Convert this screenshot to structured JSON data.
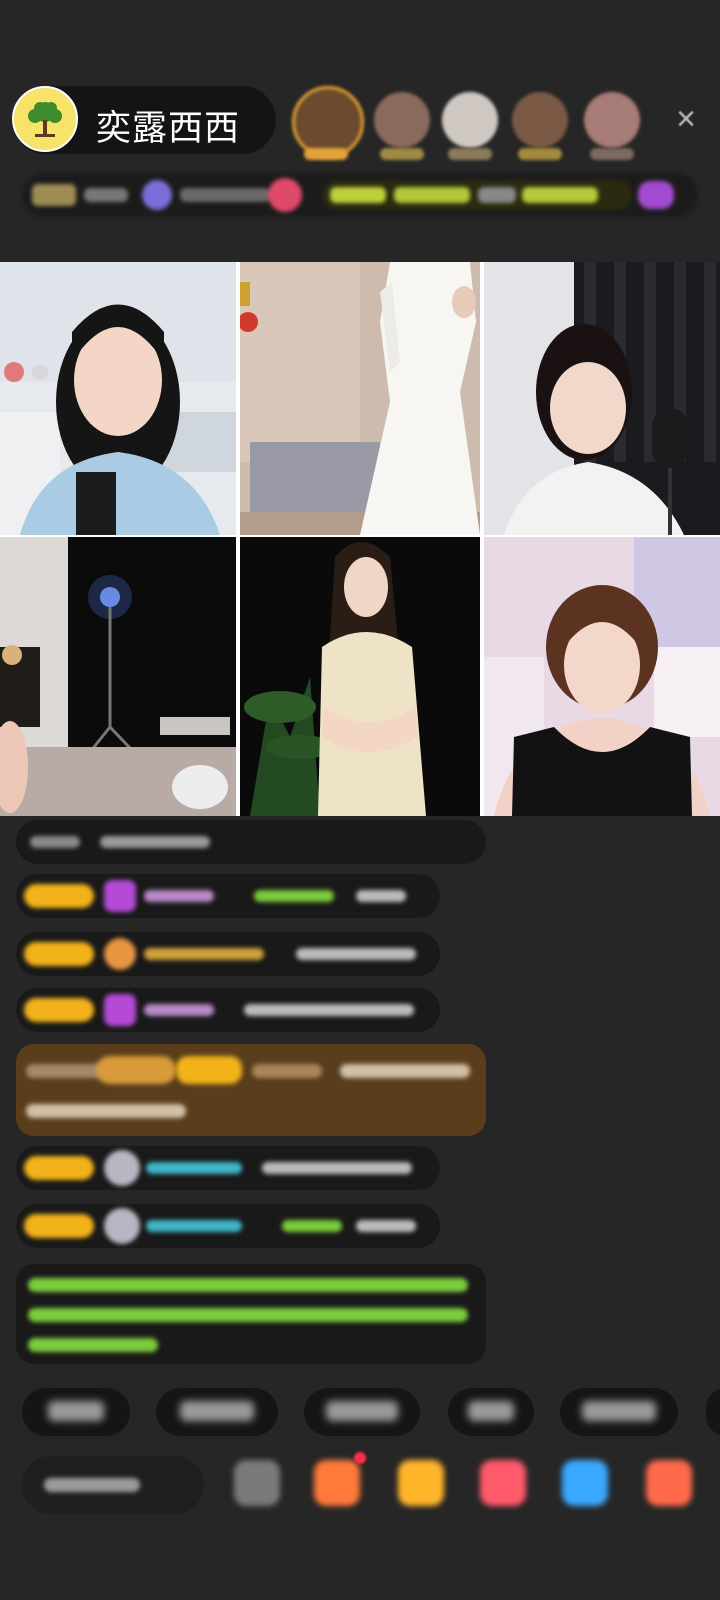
{
  "host": {
    "name": "奕露西西",
    "avatar_icon": "tree-logo-icon",
    "avatar_bg": "#f7e26a"
  },
  "header": {
    "close_icon": "close-icon",
    "close_glyph": "×"
  },
  "viewers": [
    {
      "name": "viewer-1",
      "color": "#6b4a2e"
    },
    {
      "name": "viewer-2",
      "color": "#8a6a5c"
    },
    {
      "name": "viewer-3",
      "color": "#c9c2bd"
    },
    {
      "name": "viewer-4",
      "color": "#7a5a45"
    },
    {
      "name": "viewer-5",
      "color": "#a87c76"
    }
  ],
  "grid": {
    "tiles": [
      {
        "name": "video-tile-1",
        "scene": "girl-light-blue-room"
      },
      {
        "name": "video-tile-2",
        "scene": "white-dress-bedroom"
      },
      {
        "name": "video-tile-3",
        "scene": "microphone-dark-curtain"
      },
      {
        "name": "video-tile-4",
        "scene": "dark-room-light-stand"
      },
      {
        "name": "video-tile-5",
        "scene": "cream-dress-plant"
      },
      {
        "name": "video-tile-6",
        "scene": "black-top-pink-room"
      }
    ]
  },
  "colors": {
    "background": "#262626",
    "badge_gold": "#f2b21a",
    "gift_purple": "#b44ad6",
    "name_teal": "#3fb6c8",
    "highlight_brown": "#5a3e1c",
    "green_text": "#7bcc3c"
  }
}
